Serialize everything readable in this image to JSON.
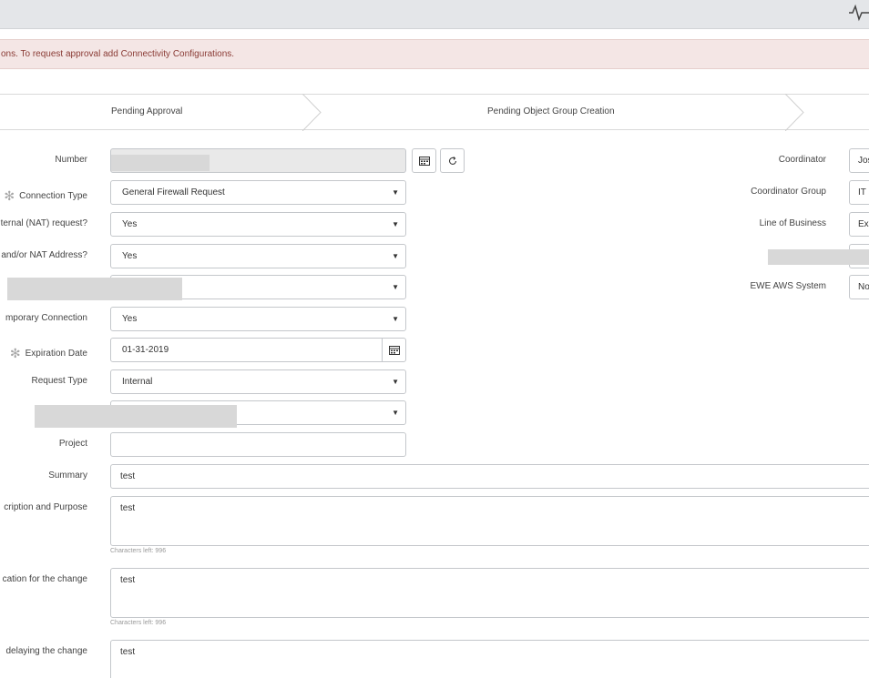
{
  "alert": {
    "text": "ons. To request approval add Connectivity Configurations."
  },
  "stages": {
    "first": "Pending Approval",
    "second": "Pending Object Group Creation"
  },
  "left": {
    "number_label": "Number",
    "connection_type_label": "Connection Type",
    "connection_type_value": "General Firewall Request",
    "nat_request_label": "ternal (NAT) request?",
    "nat_request_value": "Yes",
    "nat_address_label": "and/or NAT Address?",
    "nat_address_value": "Yes",
    "temporary_label": "mporary Connection",
    "temporary_value": "Yes",
    "expiration_label": "Expiration Date",
    "expiration_value": "01-31-2019",
    "request_type_label": "Request Type",
    "request_type_value": "Internal",
    "project_label": "Project",
    "project_value": "",
    "summary_label": "Summary",
    "summary_value": "test",
    "description_label": "cription and Purpose",
    "description_value": "test",
    "description_counter": "Characters left: 996",
    "justification_label": "cation for the change",
    "justification_value": "test",
    "justification_counter": "Characters left: 996",
    "delay_label": "delaying the change",
    "delay_value": "test"
  },
  "right": {
    "coordinator_label": "Coordinator",
    "coordinator_value": "Jos",
    "coordinator_group_label": "Coordinator Group",
    "coordinator_group_value": "IT S",
    "lob_label": "Line of Business",
    "lob_value": "Ex",
    "aws_label": "EWE AWS System",
    "aws_value": "No"
  },
  "icons": {
    "activity": "activity-pulse-icon",
    "lookup": "reference-lookup-icon",
    "refresh": "refresh-icon",
    "calendar": "calendar-icon",
    "dropdown": "chevron-down-icon"
  },
  "colors": {
    "alert_bg": "#f4e6e5",
    "alert_text": "#8a3b35",
    "topbar": "#e4e6e9",
    "readonly": "#e9e9e9"
  }
}
